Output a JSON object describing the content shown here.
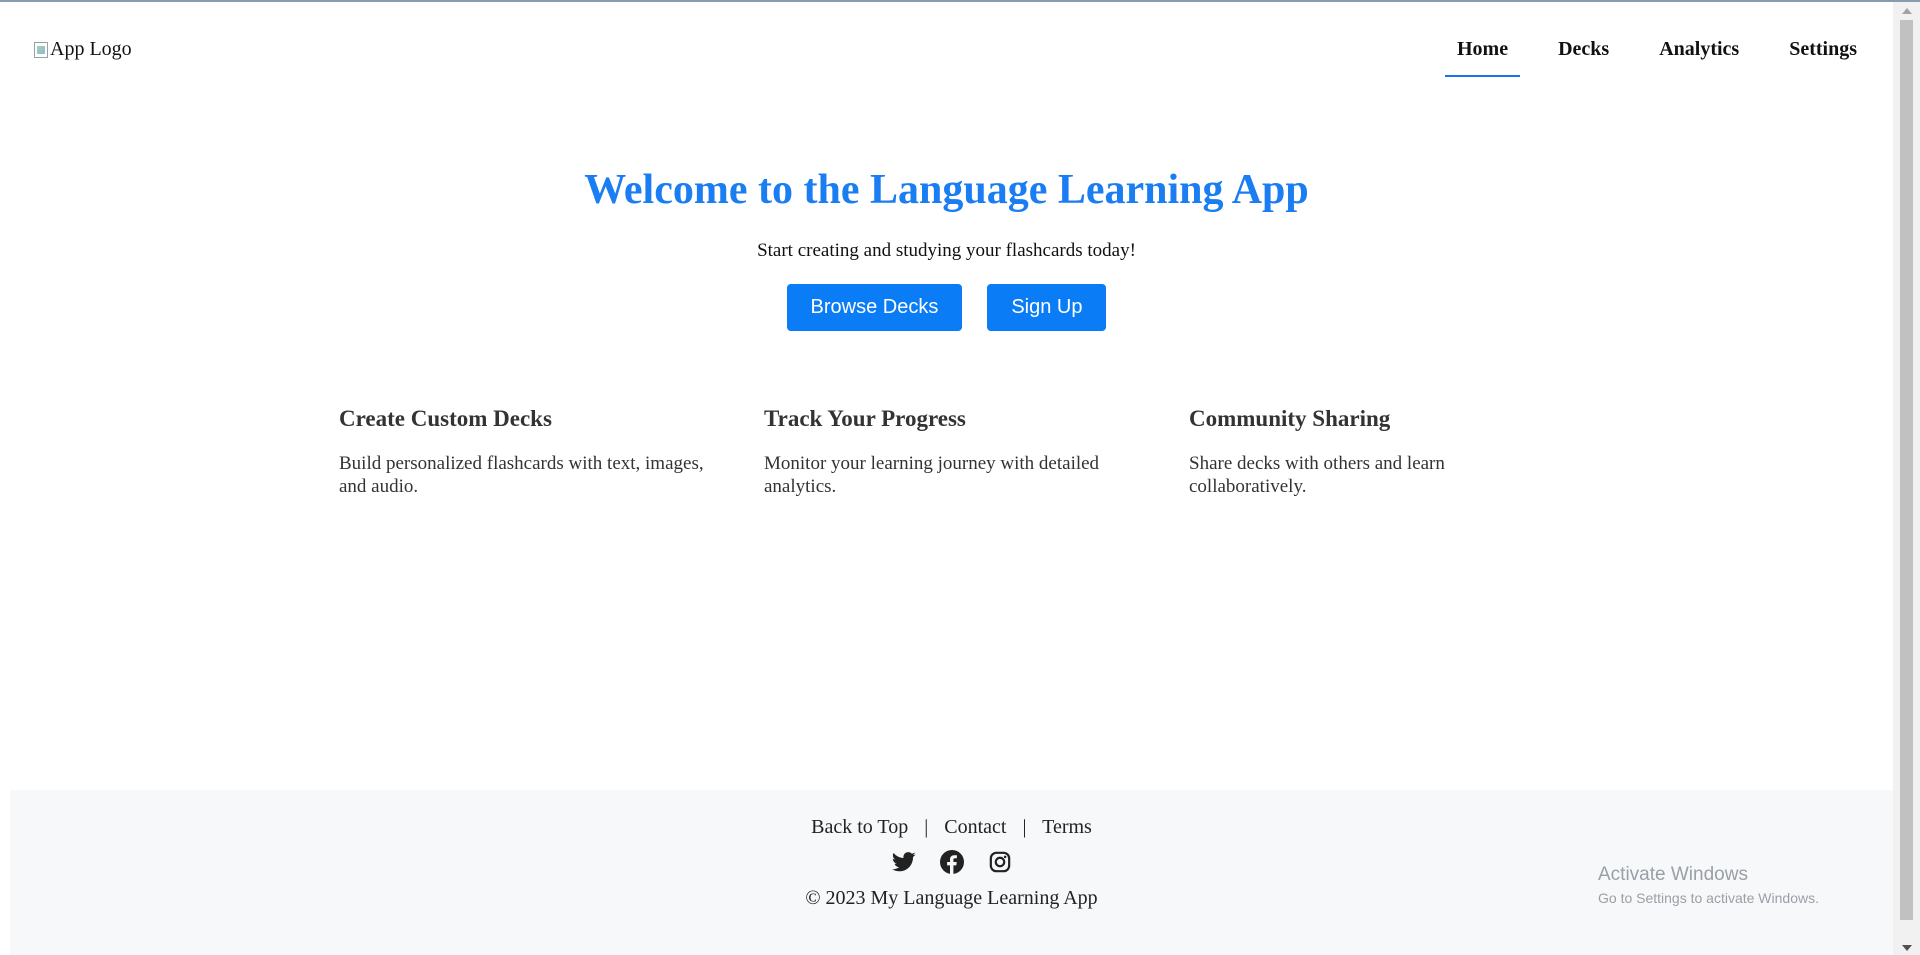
{
  "header": {
    "logo_alt": "App Logo",
    "nav": [
      {
        "label": "Home",
        "active": true
      },
      {
        "label": "Decks",
        "active": false
      },
      {
        "label": "Analytics",
        "active": false
      },
      {
        "label": "Settings",
        "active": false
      }
    ]
  },
  "hero": {
    "title": "Welcome to the Language Learning App",
    "subtitle": "Start creating and studying your flashcards today!",
    "buttons": {
      "browse": "Browse Decks",
      "signup": "Sign Up"
    }
  },
  "features": [
    {
      "title": "Create Custom Decks",
      "text": "Build personalized flashcards with text, images, and audio."
    },
    {
      "title": "Track Your Progress",
      "text": "Monitor your learning journey with detailed analytics."
    },
    {
      "title": "Community Sharing",
      "text": "Share decks with others and learn collaboratively."
    }
  ],
  "footer": {
    "links": [
      "Back to Top",
      "Contact",
      "Terms"
    ],
    "separator": "|",
    "socials": [
      "twitter-icon",
      "facebook-icon",
      "instagram-icon"
    ],
    "copyright": "© 2023 My Language Learning App"
  },
  "watermark": {
    "title": "Activate Windows",
    "subtitle": "Go to Settings to activate Windows."
  },
  "colors": {
    "accent": "#1a7ef2",
    "button": "#0a7cf6",
    "footer_bg": "#f7f8fa"
  }
}
